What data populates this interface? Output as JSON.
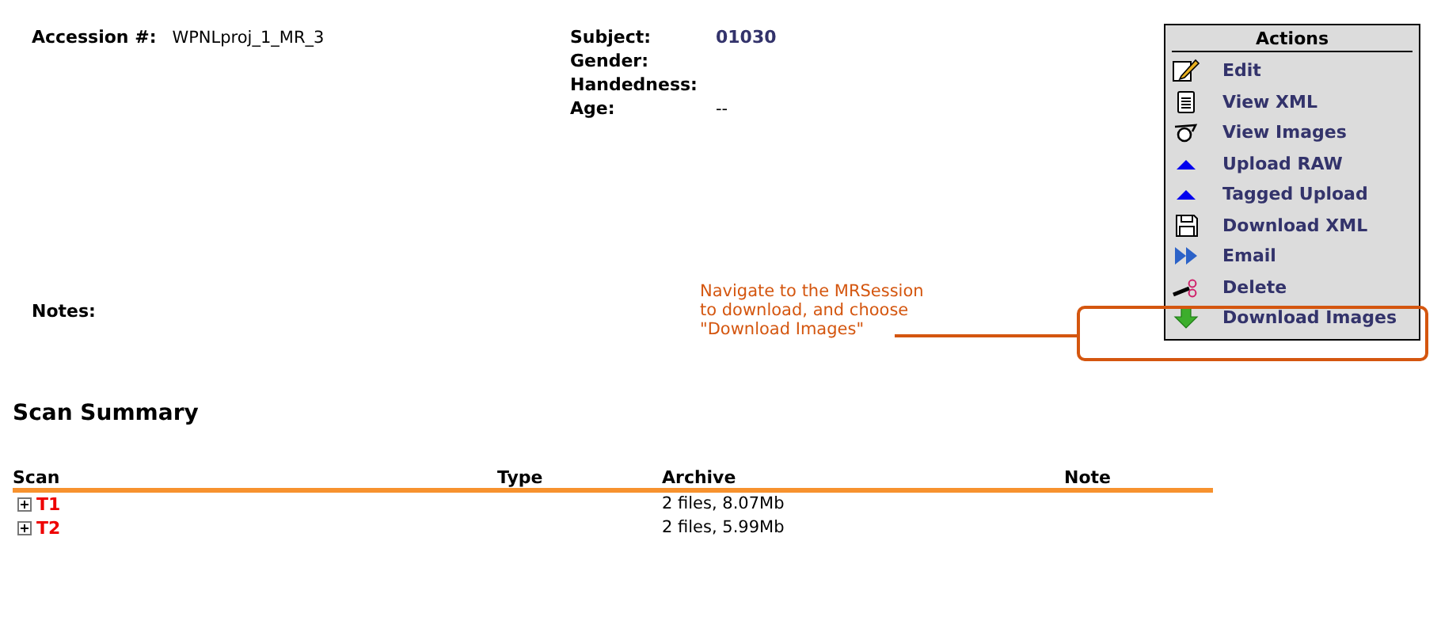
{
  "details": {
    "accession": {
      "label": "Accession #:",
      "value": "WPNLproj_1_MR_3"
    },
    "fields": [
      {
        "label": "Subject:",
        "value": "01030",
        "kind": "link"
      },
      {
        "label": "Gender:"
      },
      {
        "label": "Handedness:"
      },
      {
        "label": "Age:",
        "value": "--",
        "kind": "plain"
      }
    ],
    "notes_label": "Notes:"
  },
  "actions": {
    "title": "Actions",
    "items": [
      {
        "label": "Edit",
        "kind": "edit"
      },
      {
        "label": "View XML",
        "kind": "document"
      },
      {
        "label": "View Images",
        "kind": "glasses"
      },
      {
        "label": "Upload RAW",
        "kind": "triangle"
      },
      {
        "label": "Tagged Upload",
        "kind": "triangle"
      },
      {
        "label": "Download XML",
        "kind": "floppy"
      },
      {
        "label": "Email",
        "kind": "forward"
      },
      {
        "label": "Delete",
        "kind": "scissors"
      },
      {
        "label": "Download Images",
        "kind": "download"
      }
    ]
  },
  "annotation": {
    "lines": [
      "Navigate to the MRSession",
      "to download, and choose",
      "\"Download Images\""
    ]
  },
  "scan_summary": {
    "title": "Scan Summary",
    "columns": [
      "Scan",
      "Type",
      "Archive",
      "Note"
    ],
    "rows": [
      {
        "scan": "T1",
        "archive": "2 files, 8.07Mb",
        "expanded": false
      },
      {
        "scan": "T2",
        "archive": "2 files, 5.99Mb",
        "expanded": false
      }
    ]
  }
}
